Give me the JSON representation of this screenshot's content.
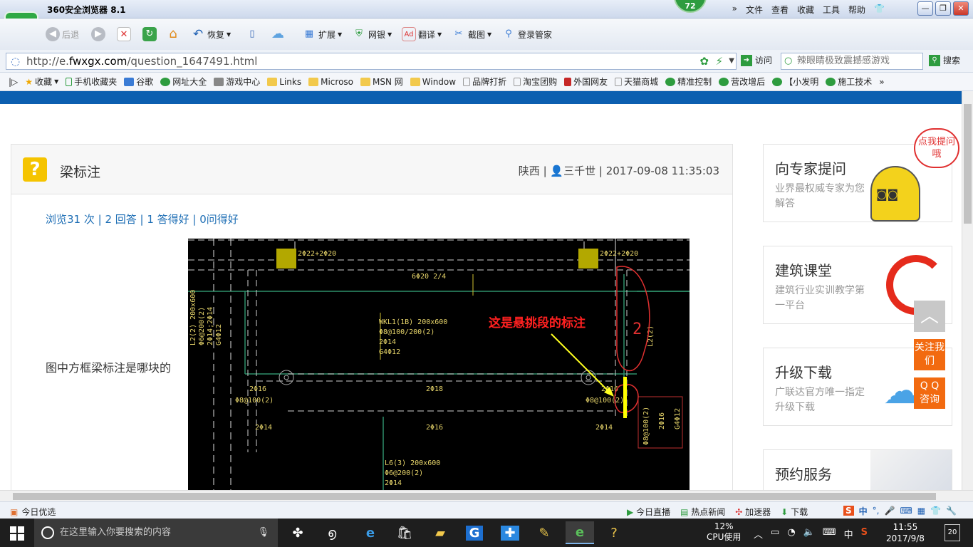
{
  "window": {
    "title": "360安全浏览器 8.1",
    "badge": "72",
    "menu": [
      "文件",
      "查看",
      "收藏",
      "工具",
      "帮助"
    ],
    "controls": [
      "—",
      "❐",
      "✕"
    ]
  },
  "toolbar": {
    "back": "后退",
    "restore": "恢复",
    "extend": "扩展",
    "bank": "网银",
    "translate": "翻译",
    "screenshot": "截图",
    "login": "登录管家"
  },
  "address": {
    "url_prefix": "http://e.",
    "url_domain": "fwxgx.com",
    "url_path": "/question_1647491.html",
    "visit": "访问",
    "search_placeholder": "辣眼睛极致震撼感游戏",
    "search": "搜索"
  },
  "bookmarks": [
    "收藏",
    "手机收藏夹",
    "谷歌",
    "网址大全",
    "游戏中心",
    "Links",
    "Microso",
    "MSN 网",
    "Window",
    "品牌打折",
    "淘宝团购",
    "外国网友",
    "天猫商城",
    "精准控制",
    "营改增后",
    "【小发明",
    "施工技术"
  ],
  "question": {
    "title": "梁标注",
    "region": "陕西",
    "user": "三千世",
    "datetime": "2017-09-08 11:35:03",
    "stats": "浏览31 次 | 2 回答 | 1 答得好 | 0问得好",
    "body": "图中方框梁标注是哪块的"
  },
  "cad": {
    "annotation": "这是悬挑段的标注",
    "labels": [
      "2Φ22+2Φ20",
      "2Φ22+2Φ20",
      "6Φ20 2/4",
      "WKL1(1B) 200x600",
      "Φ8@100/200(2)",
      "2Φ14",
      "G4Φ12",
      "2Φ16",
      "Φ8@100(2)",
      "2Φ18",
      "2Φ16",
      "Φ8@100(2)",
      "2Φ14",
      "2Φ16",
      "2Φ14",
      "L6(3) 200x600",
      "Φ6@200(2)",
      "2Φ14",
      "L2(2) 200x600",
      "Φ6@200(2)",
      "2Φ14;2Φ14",
      "G4Φ12",
      "L2(2)",
      "Φ8@100(2)",
      "2Φ16",
      "G4Φ12",
      "2"
    ]
  },
  "sidebar": [
    {
      "title": "向专家提问",
      "desc": "业界最权威专家为您解答"
    },
    {
      "title": "建筑课堂",
      "desc": "建筑行业实训教学第一平台"
    },
    {
      "title": "升级下载",
      "desc": "广联达官方唯一指定升级下载"
    },
    {
      "title": "预约服务",
      "desc": ""
    }
  ],
  "mascot_bubble": "点我提问哦",
  "floater": {
    "top": "︿",
    "follow": "关注我们",
    "qq": "Q Q 咨询"
  },
  "statusbar": {
    "left": "今日优选",
    "live": "今日直播",
    "news": "热点新闻",
    "accelerator": "加速器",
    "download": "下载",
    "ime": "中"
  },
  "taskbar": {
    "search_placeholder": "在这里输入你要搜索的内容",
    "cpu_value": "12%",
    "cpu_label": "CPU使用",
    "ime": "中",
    "time": "11:55",
    "date": "2017/9/8",
    "notifications": "20"
  }
}
